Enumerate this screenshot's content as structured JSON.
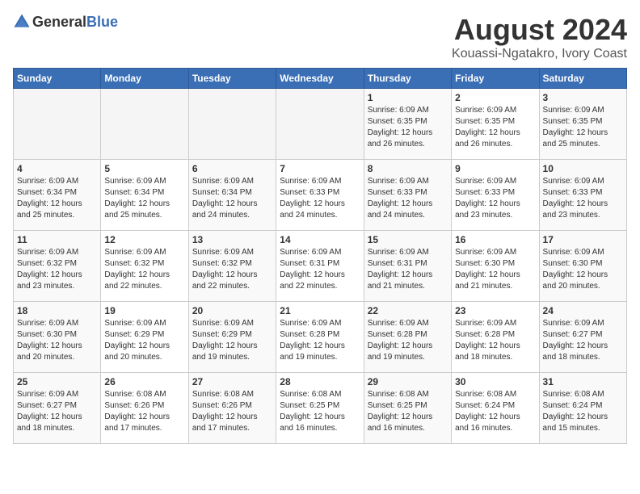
{
  "header": {
    "logo_general": "General",
    "logo_blue": "Blue",
    "month_year": "August 2024",
    "location": "Kouassi-Ngatakro, Ivory Coast"
  },
  "weekdays": [
    "Sunday",
    "Monday",
    "Tuesday",
    "Wednesday",
    "Thursday",
    "Friday",
    "Saturday"
  ],
  "weeks": [
    [
      {
        "day": "",
        "content": ""
      },
      {
        "day": "",
        "content": ""
      },
      {
        "day": "",
        "content": ""
      },
      {
        "day": "",
        "content": ""
      },
      {
        "day": "1",
        "content": "Sunrise: 6:09 AM\nSunset: 6:35 PM\nDaylight: 12 hours\nand 26 minutes."
      },
      {
        "day": "2",
        "content": "Sunrise: 6:09 AM\nSunset: 6:35 PM\nDaylight: 12 hours\nand 26 minutes."
      },
      {
        "day": "3",
        "content": "Sunrise: 6:09 AM\nSunset: 6:35 PM\nDaylight: 12 hours\nand 25 minutes."
      }
    ],
    [
      {
        "day": "4",
        "content": "Sunrise: 6:09 AM\nSunset: 6:34 PM\nDaylight: 12 hours\nand 25 minutes."
      },
      {
        "day": "5",
        "content": "Sunrise: 6:09 AM\nSunset: 6:34 PM\nDaylight: 12 hours\nand 25 minutes."
      },
      {
        "day": "6",
        "content": "Sunrise: 6:09 AM\nSunset: 6:34 PM\nDaylight: 12 hours\nand 24 minutes."
      },
      {
        "day": "7",
        "content": "Sunrise: 6:09 AM\nSunset: 6:33 PM\nDaylight: 12 hours\nand 24 minutes."
      },
      {
        "day": "8",
        "content": "Sunrise: 6:09 AM\nSunset: 6:33 PM\nDaylight: 12 hours\nand 24 minutes."
      },
      {
        "day": "9",
        "content": "Sunrise: 6:09 AM\nSunset: 6:33 PM\nDaylight: 12 hours\nand 23 minutes."
      },
      {
        "day": "10",
        "content": "Sunrise: 6:09 AM\nSunset: 6:33 PM\nDaylight: 12 hours\nand 23 minutes."
      }
    ],
    [
      {
        "day": "11",
        "content": "Sunrise: 6:09 AM\nSunset: 6:32 PM\nDaylight: 12 hours\nand 23 minutes."
      },
      {
        "day": "12",
        "content": "Sunrise: 6:09 AM\nSunset: 6:32 PM\nDaylight: 12 hours\nand 22 minutes."
      },
      {
        "day": "13",
        "content": "Sunrise: 6:09 AM\nSunset: 6:32 PM\nDaylight: 12 hours\nand 22 minutes."
      },
      {
        "day": "14",
        "content": "Sunrise: 6:09 AM\nSunset: 6:31 PM\nDaylight: 12 hours\nand 22 minutes."
      },
      {
        "day": "15",
        "content": "Sunrise: 6:09 AM\nSunset: 6:31 PM\nDaylight: 12 hours\nand 21 minutes."
      },
      {
        "day": "16",
        "content": "Sunrise: 6:09 AM\nSunset: 6:30 PM\nDaylight: 12 hours\nand 21 minutes."
      },
      {
        "day": "17",
        "content": "Sunrise: 6:09 AM\nSunset: 6:30 PM\nDaylight: 12 hours\nand 20 minutes."
      }
    ],
    [
      {
        "day": "18",
        "content": "Sunrise: 6:09 AM\nSunset: 6:30 PM\nDaylight: 12 hours\nand 20 minutes."
      },
      {
        "day": "19",
        "content": "Sunrise: 6:09 AM\nSunset: 6:29 PM\nDaylight: 12 hours\nand 20 minutes."
      },
      {
        "day": "20",
        "content": "Sunrise: 6:09 AM\nSunset: 6:29 PM\nDaylight: 12 hours\nand 19 minutes."
      },
      {
        "day": "21",
        "content": "Sunrise: 6:09 AM\nSunset: 6:28 PM\nDaylight: 12 hours\nand 19 minutes."
      },
      {
        "day": "22",
        "content": "Sunrise: 6:09 AM\nSunset: 6:28 PM\nDaylight: 12 hours\nand 19 minutes."
      },
      {
        "day": "23",
        "content": "Sunrise: 6:09 AM\nSunset: 6:28 PM\nDaylight: 12 hours\nand 18 minutes."
      },
      {
        "day": "24",
        "content": "Sunrise: 6:09 AM\nSunset: 6:27 PM\nDaylight: 12 hours\nand 18 minutes."
      }
    ],
    [
      {
        "day": "25",
        "content": "Sunrise: 6:09 AM\nSunset: 6:27 PM\nDaylight: 12 hours\nand 18 minutes."
      },
      {
        "day": "26",
        "content": "Sunrise: 6:08 AM\nSunset: 6:26 PM\nDaylight: 12 hours\nand 17 minutes."
      },
      {
        "day": "27",
        "content": "Sunrise: 6:08 AM\nSunset: 6:26 PM\nDaylight: 12 hours\nand 17 minutes."
      },
      {
        "day": "28",
        "content": "Sunrise: 6:08 AM\nSunset: 6:25 PM\nDaylight: 12 hours\nand 16 minutes."
      },
      {
        "day": "29",
        "content": "Sunrise: 6:08 AM\nSunset: 6:25 PM\nDaylight: 12 hours\nand 16 minutes."
      },
      {
        "day": "30",
        "content": "Sunrise: 6:08 AM\nSunset: 6:24 PM\nDaylight: 12 hours\nand 16 minutes."
      },
      {
        "day": "31",
        "content": "Sunrise: 6:08 AM\nSunset: 6:24 PM\nDaylight: 12 hours\nand 15 minutes."
      }
    ]
  ]
}
